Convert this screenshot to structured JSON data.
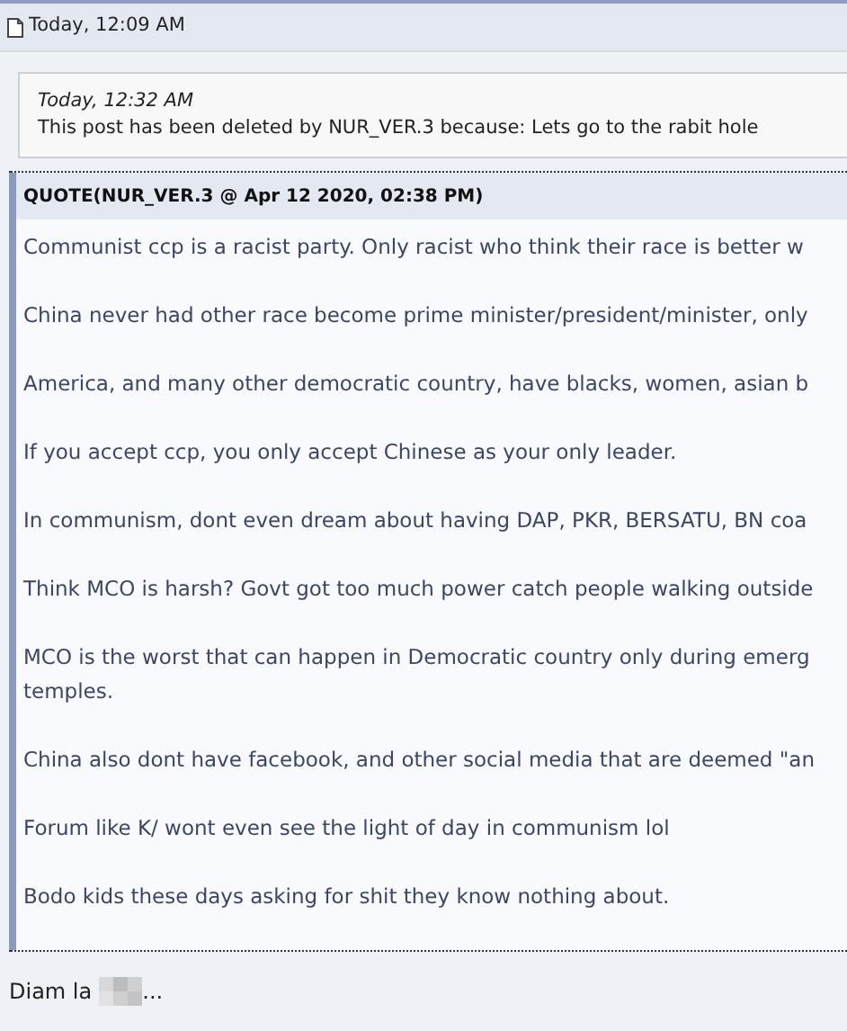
{
  "post": {
    "timestamp": "Today, 12:09 AM"
  },
  "deleted_notice": {
    "time": "Today, 12:32 AM",
    "message": "This post has been deleted by NUR_VER.3 because: Lets go to the rabit hole"
  },
  "quote": {
    "header": "QUOTE(NUR_VER.3 @ Apr 12 2020, 02:38 PM)",
    "paragraphs": [
      [
        "Communist ccp is a racist party. Only racist who think their race is better w"
      ],
      [
        "China never had other race become prime minister/president/minister, only"
      ],
      [
        "America, and many other democratic country, have blacks, women, asian b"
      ],
      [
        "If you accept ccp, you only accept Chinese as your only leader."
      ],
      [
        "In communism, dont even dream about having DAP, PKR, BERSATU, BN coa"
      ],
      [
        "Think MCO is harsh? Govt got too much power catch people walking outside"
      ],
      [
        "MCO is the worst that can happen in Democratic country only during emerg",
        "temples."
      ],
      [
        "China also dont have facebook, and other social media that are deemed \"an"
      ],
      [
        "Forum like K/ wont even see the light of day in communism lol"
      ],
      [
        "Bodo kids these days asking for shit they know nothing about."
      ]
    ]
  },
  "reply": {
    "text": "Diam la",
    "redacted": true,
    "trailing": "..."
  }
}
